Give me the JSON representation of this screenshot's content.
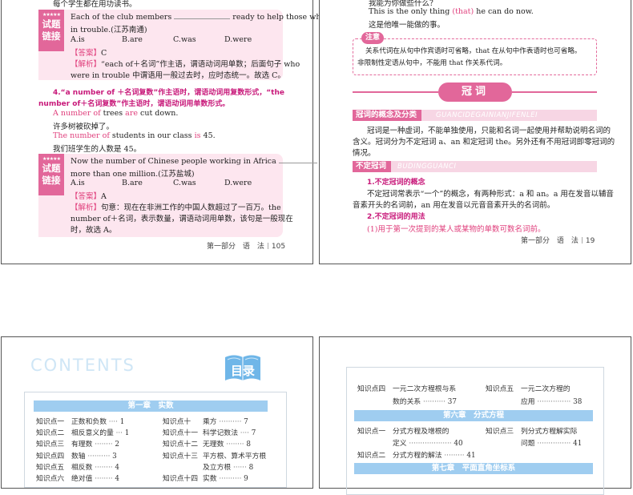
{
  "page1": {
    "top_line": "每个学生都在用功读书。",
    "ex_tag_stars": "★★★★★",
    "ex_tag_l1": "试题",
    "ex_tag_l2": "链接",
    "ex1": {
      "q_part1": "Each of the club members",
      "q_part2": "ready to help those who were",
      "q_line2": "in trouble.(江苏南通)",
      "choices": [
        "A.is",
        "B.are",
        "C.was",
        "D.were"
      ],
      "answer_label": "【答案】",
      "answer": "C",
      "expl_label": "【解析】",
      "expl1": "“each of＋名词”作主语，谓语动词用单数；后面句子 who",
      "expl2": "were in trouble 中谓语用一般过去时，应时态统一。故选 C。"
    },
    "rule4_l1": "4.“a number of ＋名词复数”作主语时，谓语动词用复数形式，“the",
    "rule4_l2": "number of＋名词复数”作主语时，谓语动词用单数形式。",
    "s1_part1": "A number of",
    "s1_part2": " trees ",
    "s1_part3": "are",
    "s1_part4": " cut down.",
    "s1_zh": "许多树被砍掉了。",
    "s2_part1": "The number of",
    "s2_part2": " students in our class ",
    "s2_part3": "is",
    "s2_part4": " 45.",
    "s2_zh": "我们班学生的人数是 45。",
    "ex2": {
      "q_part1": "Now the number of Chinese people working in Africa",
      "q_line2": "more than one million.(江苏盐城)",
      "choices": [
        "A.is",
        "B.are",
        "C.was",
        "D.were"
      ],
      "answer_label": "【答案】",
      "answer": "A",
      "expl_label": "【解析】",
      "expl1": "句意：现在在非洲工作的中国人数超过了一百万。the",
      "expl2": "number of＋名词，表示数量，谓语动词用单数，该句是一般现在",
      "expl3": "时，故选 A。"
    },
    "footer_part": "第一部分",
    "footer_section": "语　法",
    "footer_page": "105"
  },
  "page2": {
    "top_line1": "我能为你做些什么？",
    "top_line2_part1": "This is the only thing ",
    "top_line2_that": "(that)",
    "top_line2_part2": " he can do now.",
    "top_line3": "这是他唯一能做的事。",
    "note_tag": "注意",
    "note_l1": "关系代词在从句中作宾语时可省略，that 在从句中作表语时也可省略。",
    "note_l2": "非限制性定语从句中，不能用 that 作关系代词。",
    "title": "冠词",
    "sec1_label": "冠词的概念及分类",
    "sec1_pinyin": "GUANCIDEGAINIANJIFENLEI",
    "sec1_p1": "冠词是一种虚词，不能单独使用，只能和名词一起使用并帮助说明名词的",
    "sec1_p2": "含义。冠词分为不定冠词 a、an 和定冠词 the。另外还有不用冠词即零冠词的",
    "sec1_p3": "情况。",
    "sec2_label": "不定冠词",
    "sec2_pinyin": "BUDINGGUANCI",
    "h1": "1.不定冠词的概念",
    "h1_p1": "不定冠词常表示“一个”的概念，有两种形式：a 和 an。a 用在发音以辅音",
    "h1_p2": "音素开头的名词前，an 用在发音以元音音素开头的名词前。",
    "h2": "2.不定冠词的用法",
    "h2_p1": "(1)用于第一次提到的某人或某物的单数可数名词前。",
    "footer_part": "第一部分",
    "footer_section": "语　法",
    "footer_page": "19"
  },
  "page3": {
    "contents_word": "CONTENTS",
    "mulu": "目录",
    "chapter1": "第一章　实数",
    "left_items": [
      {
        "kp": "知识点一",
        "t": "正数和负数",
        "p": "1"
      },
      {
        "kp": "知识点二",
        "t": "相反意义的量",
        "p": "1"
      },
      {
        "kp": "知识点三",
        "t": "有理数",
        "p": "2"
      },
      {
        "kp": "知识点四",
        "t": "数轴",
        "p": "3"
      },
      {
        "kp": "知识点五",
        "t": "相反数",
        "p": "4"
      },
      {
        "kp": "知识点六",
        "t": "绝对值",
        "p": "4"
      }
    ],
    "right_items": [
      {
        "kp": "知识点十",
        "t": "乘方",
        "p": "7"
      },
      {
        "kp": "知识点十一",
        "t": "科学记数法",
        "p": "7"
      },
      {
        "kp": "知识点十二",
        "t": "无理数",
        "p": "8"
      },
      {
        "kp": "知识点十三",
        "t": "平方根、算术平方根",
        "p": ""
      },
      {
        "kp": "",
        "t": "及立方根",
        "p": "8"
      },
      {
        "kp": "知识点十四",
        "t": "实数",
        "p": "9"
      }
    ]
  },
  "page4": {
    "r1_kp": "知识点四",
    "r1_t1": "一元二次方程根与系",
    "r1_t2": "数的关系",
    "r1_p": "37",
    "r1b_kp": "知识点五",
    "r1b_t1": "一元二次方程的",
    "r1b_t2": "应用",
    "r1b_p": "38",
    "chapter6": "第六章　分式方程",
    "c6a_kp": "知识点一",
    "c6a_t1": "分式方程及增根的",
    "c6a_t2": "定义",
    "c6a_p": "40",
    "c6b_kp": "知识点三",
    "c6b_t1": "列分式方程解实际",
    "c6b_t2": "问题",
    "c6b_p": "41",
    "c6c_kp": "知识点二",
    "c6c_t": "分式方程的解法",
    "c6c_p": "41",
    "chapter7": "第七章　平面直角坐标系"
  },
  "colors": {
    "accent_pink": "#e2679a",
    "light_pink": "#fde6ef",
    "chapter_blue": "#9fcdf0"
  }
}
